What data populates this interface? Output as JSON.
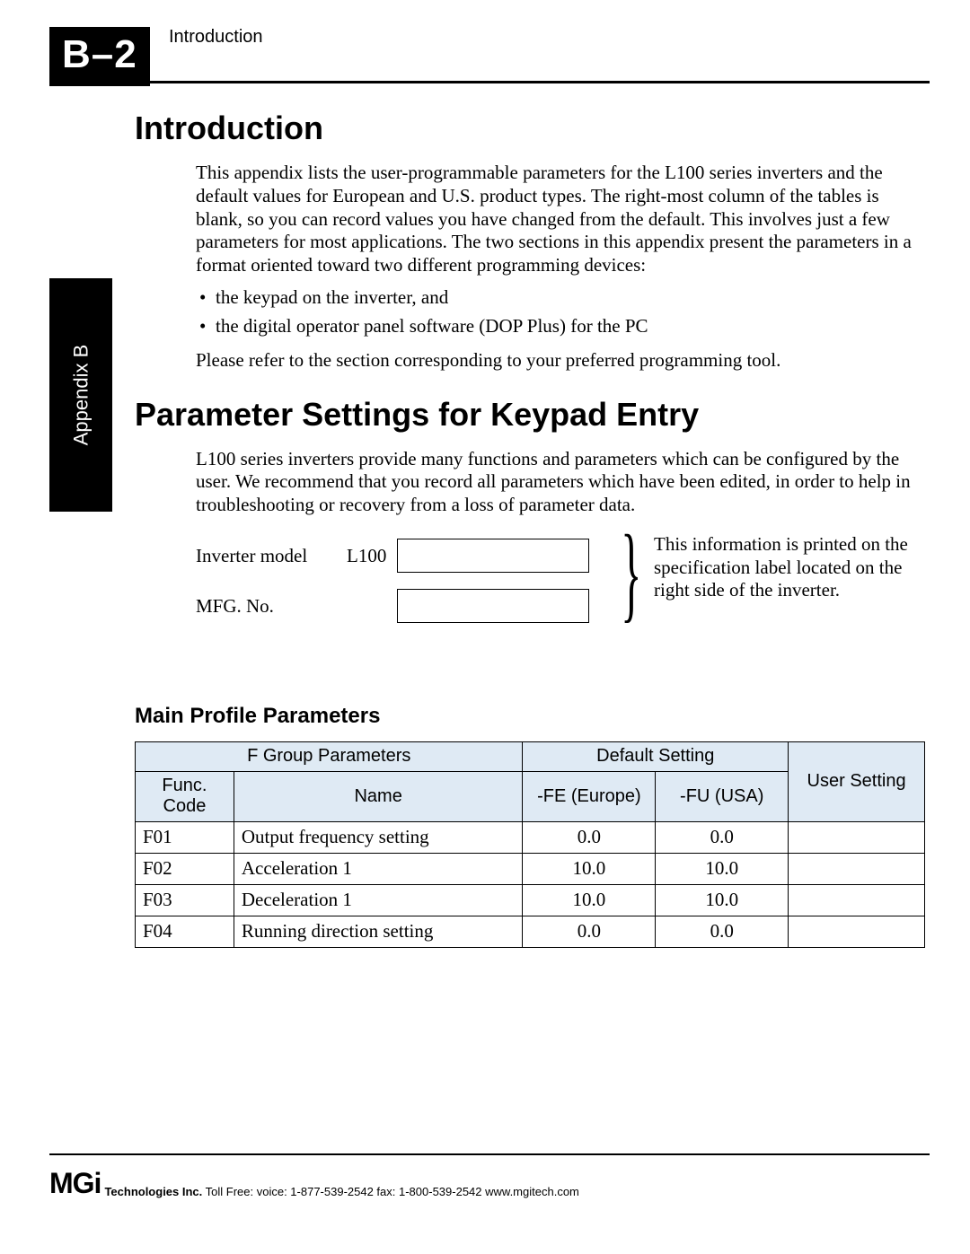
{
  "header": {
    "page_label": "B–2",
    "running_title": "Introduction"
  },
  "side_tab": "Appendix B",
  "section1": {
    "title": "Introduction",
    "para1": "This appendix lists the user-programmable parameters for the L100 series inverters and the default values for European and U.S. product types. The right-most column of the tables is blank, so you can record values you have changed from the default. This involves just a few parameters for most applications. The two sections in this appendix present the parameters in a format oriented toward two different programming devices:",
    "bullet1": "the keypad on the inverter, and",
    "bullet2": "the digital operator panel software (DOP Plus) for the PC",
    "para2": "Please refer to the section corresponding to your preferred programming tool."
  },
  "section2": {
    "title": "Parameter Settings for Keypad Entry",
    "para1": "L100 series inverters provide many functions and parameters which can be configured by the user. We recommend that you record all parameters which have been edited, in order to help in troubleshooting or recovery from a loss of parameter data.",
    "record": {
      "label_model": "Inverter model",
      "prefix_model": "L100",
      "label_mfg": "MFG. No.",
      "note": "This information is printed on the specification label located on the right side of the inverter."
    },
    "subheading": "Main Profile Parameters",
    "table": {
      "h_group": "F  Group Parameters",
      "h_default": "Default Setting",
      "h_user": "User Setting",
      "h_code": "Func. Code",
      "h_name": "Name",
      "h_fe": "-FE (Europe)",
      "h_fu": "-FU (USA)",
      "rows": [
        {
          "code": "F01",
          "name": "Output frequency setting",
          "fe": "0.0",
          "fu": "0.0",
          "user": ""
        },
        {
          "code": "F02",
          "name": "Acceleration 1",
          "fe": "10.0",
          "fu": "10.0",
          "user": ""
        },
        {
          "code": "F03",
          "name": "Deceleration 1",
          "fe": "10.0",
          "fu": "10.0",
          "user": ""
        },
        {
          "code": "F04",
          "name": "Running direction setting",
          "fe": "0.0",
          "fu": "0.0",
          "user": ""
        }
      ]
    }
  },
  "footer": {
    "logo_text": "MGi",
    "company_bold": "Technologies Inc.",
    "contact": " Toll Free:  voice: 1-877-539-2542  fax: 1-800-539-2542   www.mgitech.com"
  }
}
